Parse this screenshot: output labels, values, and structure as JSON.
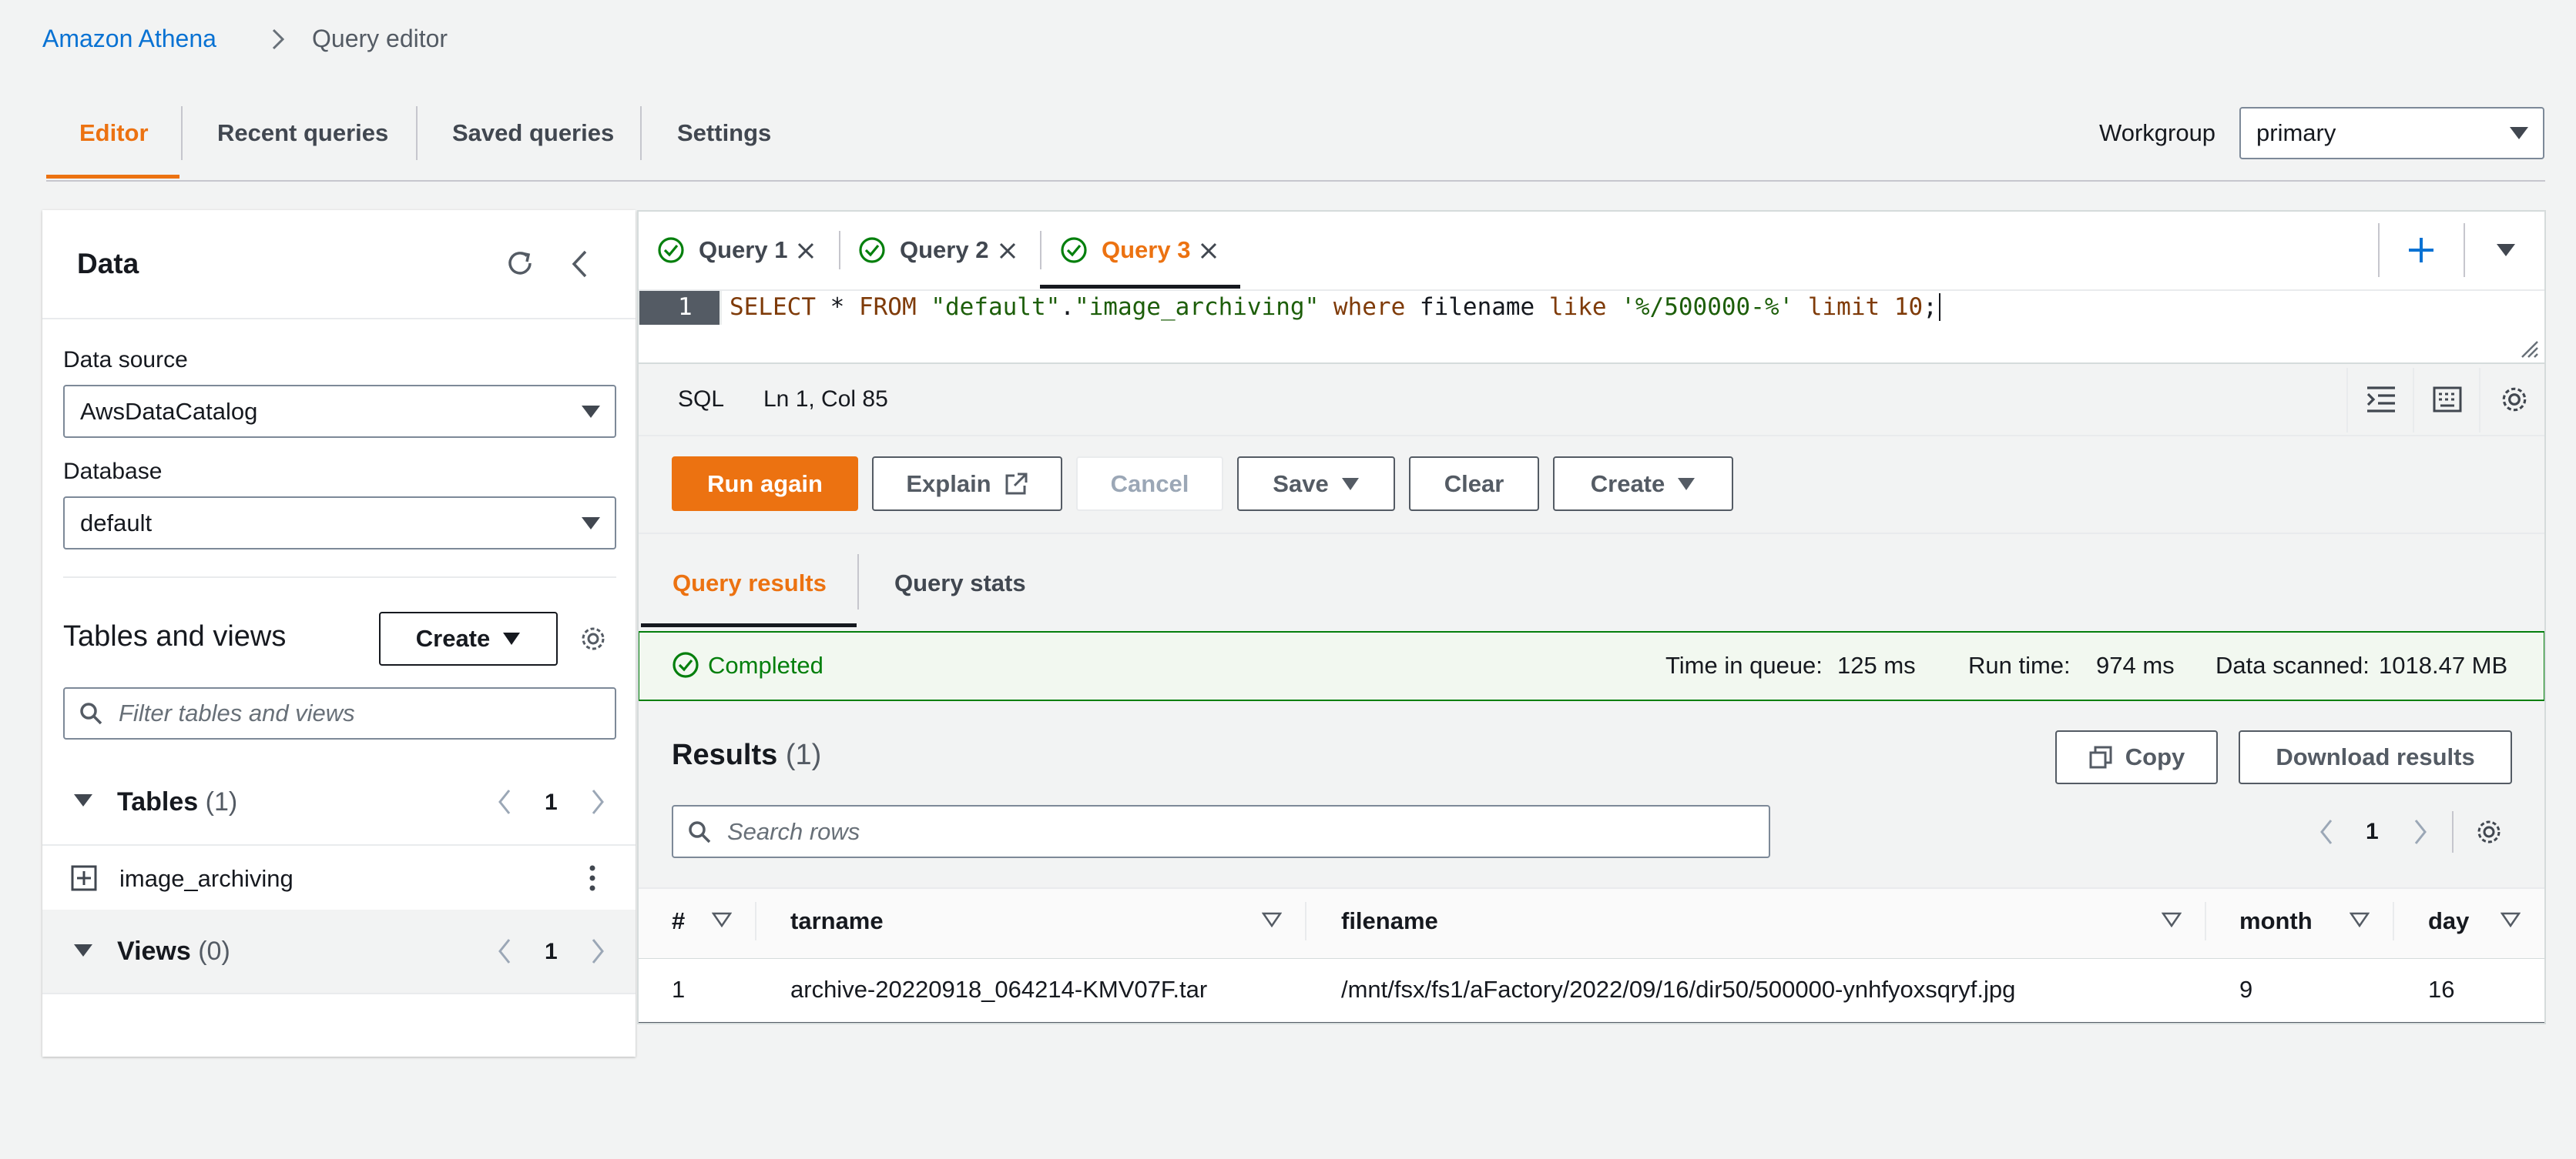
{
  "breadcrumb": {
    "service": "Amazon Athena",
    "current": "Query editor"
  },
  "top_tabs": [
    "Editor",
    "Recent queries",
    "Saved queries",
    "Settings"
  ],
  "workgroup": {
    "label": "Workgroup",
    "value": "primary"
  },
  "data_panel": {
    "title": "Data",
    "data_source_label": "Data source",
    "data_source_value": "AwsDataCatalog",
    "database_label": "Database",
    "database_value": "default",
    "tables_views_title": "Tables and views",
    "create_label": "Create",
    "filter_placeholder": "Filter tables and views",
    "tables_label": "Tables",
    "tables_count": "(1)",
    "tables_page": "1",
    "table_item": "image_archiving",
    "views_label": "Views",
    "views_count": "(0)",
    "views_page": "1"
  },
  "query_tabs": [
    {
      "label": "Query 1"
    },
    {
      "label": "Query 2"
    },
    {
      "label": "Query 3"
    }
  ],
  "editor": {
    "line_number": "1",
    "tokens": {
      "select": "SELECT",
      "star": " * ",
      "from": "FROM",
      "sp1": " ",
      "db": "\"default\"",
      "dot": ".",
      "table": "\"image_archiving\"",
      "sp2": " ",
      "where": "where",
      "sp3": " filename ",
      "like": "like",
      "sp4": " ",
      "pattern": "'%/500000-%'",
      "sp5": " ",
      "limit": "limit",
      "sp6": " ",
      "limitval": "10",
      "semi": ";"
    },
    "language": "SQL",
    "position": "Ln 1, Col 85"
  },
  "actions": {
    "run_again": "Run again",
    "explain": "Explain",
    "cancel": "Cancel",
    "save": "Save",
    "clear": "Clear",
    "create": "Create"
  },
  "result_tabs": [
    "Query results",
    "Query stats"
  ],
  "status": {
    "state": "Completed",
    "queue_label": "Time in queue:",
    "queue_value": "125 ms",
    "run_label": "Run time:",
    "run_value": "974 ms",
    "scanned_label": "Data scanned:",
    "scanned_value": "1018.47 MB"
  },
  "results": {
    "title": "Results",
    "count": "(1)",
    "copy": "Copy",
    "download": "Download results",
    "search_placeholder": "Search rows",
    "page": "1",
    "columns": [
      "#",
      "tarname",
      "filename",
      "month",
      "day"
    ],
    "rows": [
      [
        "1",
        "archive-20220918_064214-KMV07F.tar",
        "/mnt/fsx/fs1/aFactory/2022/09/16/dir50/500000-ynhfyoxsqryf.jpg",
        "9",
        "16"
      ]
    ]
  },
  "colors": {
    "accent": "#ec7211",
    "link": "#0972d3",
    "success": "#037f0c"
  }
}
